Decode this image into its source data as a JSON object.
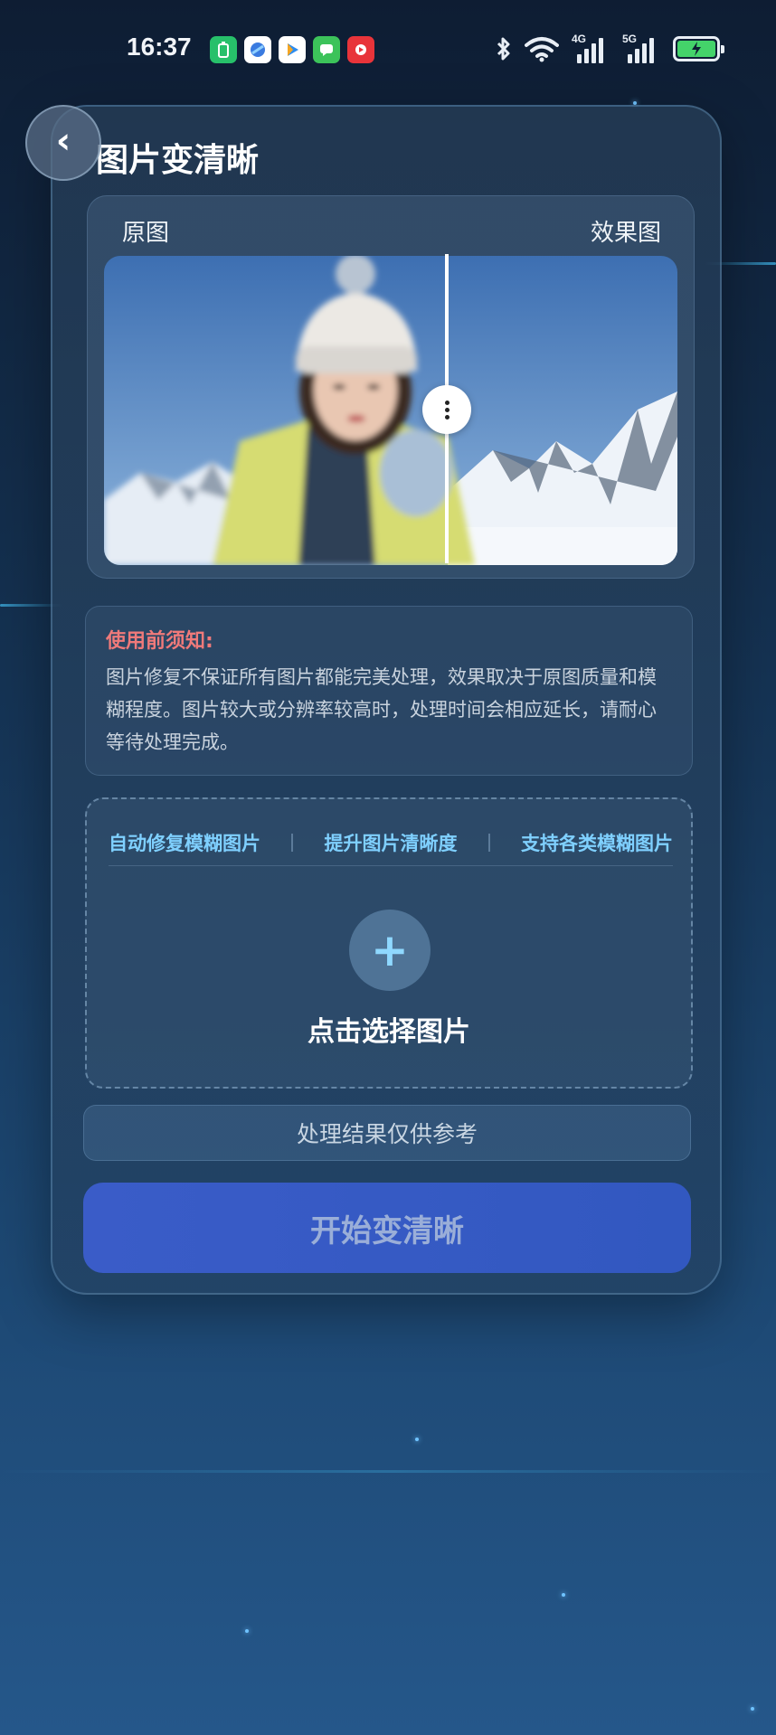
{
  "status_bar": {
    "time": "16:37",
    "net1": "4G",
    "net2": "5G",
    "app_icons": [
      "battery-saver-icon",
      "browser-icon",
      "video-player-icon",
      "messages-icon",
      "video-app-icon"
    ]
  },
  "header": {
    "title": "图片变清晰",
    "back_icon": "‹"
  },
  "compare": {
    "left_label": "原图",
    "right_label": "效果图",
    "slider_position": 0.6
  },
  "notice": {
    "title": "使用前须知:",
    "body": "图片修复不保证所有图片都能完美处理，效果取决于原图质量和模糊程度。图片较大或分辨率较高时，处理时间会相应延长，请耐心等待处理完成。"
  },
  "upload": {
    "features": [
      "自动修复模糊图片",
      "提升图片清晰度",
      "支持各类模糊图片"
    ],
    "plus": "+",
    "label": "点击选择图片"
  },
  "disclaimer": "处理结果仅供参考",
  "start_button": "开始变清晰",
  "colors": {
    "accent": "#7fd0ff",
    "warning": "#f07a7a",
    "button": "#3a5cc8"
  }
}
